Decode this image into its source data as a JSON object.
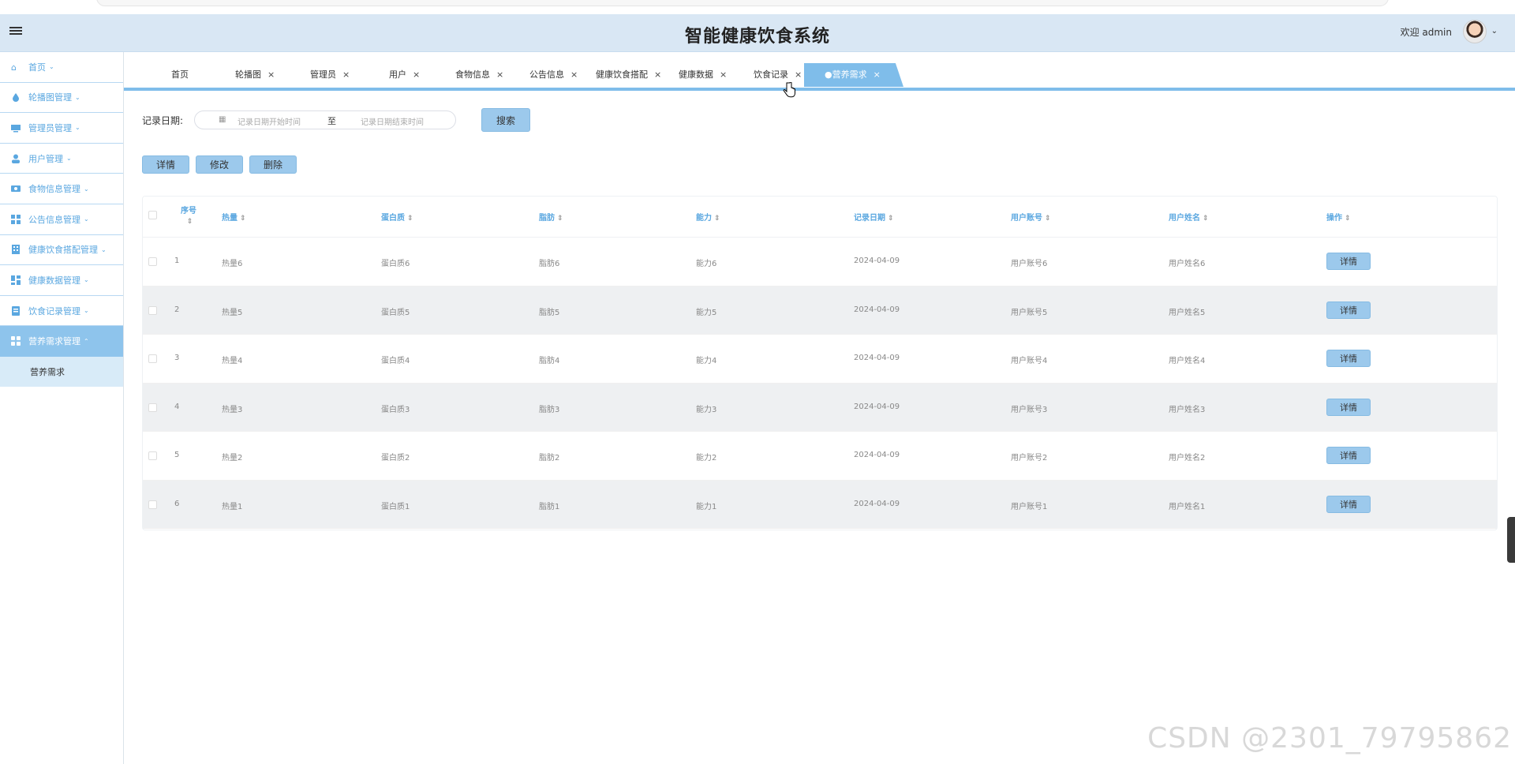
{
  "header": {
    "title": "智能健康饮食系统",
    "welcome": "欢迎 admin"
  },
  "sidebar": {
    "items": [
      {
        "label": "首页",
        "icon": "home-icon"
      },
      {
        "label": "轮播图管理",
        "icon": "drop-icon"
      },
      {
        "label": "管理员管理",
        "icon": "monitor-icon"
      },
      {
        "label": "用户管理",
        "icon": "user-icon"
      },
      {
        "label": "食物信息管理",
        "icon": "card-icon"
      },
      {
        "label": "公告信息管理",
        "icon": "grid-icon"
      },
      {
        "label": "健康饮食搭配管理",
        "icon": "building-icon"
      },
      {
        "label": "健康数据管理",
        "icon": "dashboard-icon"
      },
      {
        "label": "饮食记录管理",
        "icon": "doc-icon"
      },
      {
        "label": "营养需求管理",
        "icon": "apps-icon"
      }
    ],
    "sub_item": "营养需求"
  },
  "tabs": [
    {
      "label": "首页"
    },
    {
      "label": "轮播图"
    },
    {
      "label": "管理员"
    },
    {
      "label": "用户"
    },
    {
      "label": "食物信息"
    },
    {
      "label": "公告信息"
    },
    {
      "label": "健康饮食搭配"
    },
    {
      "label": "健康数据"
    },
    {
      "label": "饮食记录"
    },
    {
      "label": "●营养需求"
    }
  ],
  "search": {
    "label": "记录日期:",
    "start_placeholder": "记录日期开始时间",
    "separator": "至",
    "end_placeholder": "记录日期结束时间",
    "button": "搜索"
  },
  "actions": {
    "detail": "详情",
    "edit": "修改",
    "delete": "删除"
  },
  "table": {
    "headers": {
      "seq": "序号",
      "calories": "热量",
      "protein": "蛋白质",
      "fat": "脂肪",
      "ability": "能力",
      "date": "记录日期",
      "account": "用户账号",
      "name": "用户姓名",
      "ops": "操作"
    },
    "row_button": "详情",
    "rows": [
      {
        "seq": "1",
        "calories": "热量6",
        "protein": "蛋白质6",
        "fat": "脂肪6",
        "ability": "能力6",
        "date": "2024-04-09",
        "account": "用户账号6",
        "name": "用户姓名6"
      },
      {
        "seq": "2",
        "calories": "热量5",
        "protein": "蛋白质5",
        "fat": "脂肪5",
        "ability": "能力5",
        "date": "2024-04-09",
        "account": "用户账号5",
        "name": "用户姓名5"
      },
      {
        "seq": "3",
        "calories": "热量4",
        "protein": "蛋白质4",
        "fat": "脂肪4",
        "ability": "能力4",
        "date": "2024-04-09",
        "account": "用户账号4",
        "name": "用户姓名4"
      },
      {
        "seq": "4",
        "calories": "热量3",
        "protein": "蛋白质3",
        "fat": "脂肪3",
        "ability": "能力3",
        "date": "2024-04-09",
        "account": "用户账号3",
        "name": "用户姓名3"
      },
      {
        "seq": "5",
        "calories": "热量2",
        "protein": "蛋白质2",
        "fat": "脂肪2",
        "ability": "能力2",
        "date": "2024-04-09",
        "account": "用户账号2",
        "name": "用户姓名2"
      },
      {
        "seq": "6",
        "calories": "热量1",
        "protein": "蛋白质1",
        "fat": "脂肪1",
        "ability": "能力1",
        "date": "2024-04-09",
        "account": "用户账号1",
        "name": "用户姓名1"
      }
    ]
  },
  "watermark": "CSDN @2301_79795862",
  "colors": {
    "accent": "#7fbdea",
    "header_bg": "#d9e7f4",
    "sidebar_text": "#5aa7e0",
    "button_bg": "#9cc9ec"
  }
}
